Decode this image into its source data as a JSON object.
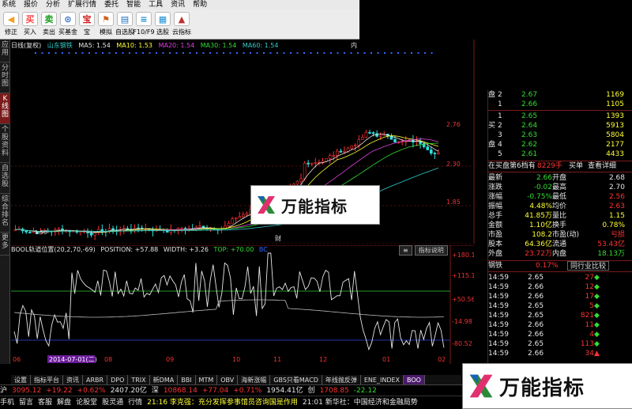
{
  "menu": [
    "系统",
    "报价",
    "分析",
    "扩展行情",
    "委托",
    "智能",
    "工具",
    "资讯",
    "帮助"
  ],
  "toolbar": [
    {
      "label": "修正",
      "icon": "back-arrow",
      "color": "#f0a020",
      "glyph": "◀"
    },
    {
      "label": "买入",
      "icon": "buy",
      "color": "#ff4040",
      "glyph": "买"
    },
    {
      "label": "卖出",
      "icon": "sell",
      "color": "#20a020",
      "glyph": "卖"
    },
    {
      "label": "买基金",
      "icon": "fund",
      "color": "#2060c0",
      "glyph": "⊙"
    },
    {
      "label": "宝",
      "icon": "treasure",
      "color": "#d02020",
      "glyph": "宝"
    },
    {
      "label": "模拟",
      "icon": "simulate",
      "color": "#d06020",
      "glyph": "⚑"
    },
    {
      "label": "自选股",
      "icon": "watchlist",
      "color": "#2070c0",
      "glyph": "▤"
    },
    {
      "label": "F10/F9",
      "icon": "f10",
      "color": "#2090d0",
      "glyph": "≡"
    },
    {
      "label": "选股",
      "icon": "screener",
      "color": "#2090d0",
      "glyph": "▦"
    },
    {
      "label": "云指标",
      "icon": "cloud-indicator",
      "color": "#c03030",
      "glyph": "▲"
    }
  ],
  "lefttabs": [
    {
      "label": "应用",
      "active": false
    },
    {
      "label": "分时图",
      "active": false
    },
    {
      "label": "K线图",
      "active": true
    },
    {
      "label": "个股资料",
      "active": false
    },
    {
      "label": "自选股",
      "active": false
    },
    {
      "label": "综合排名",
      "active": false
    },
    {
      "label": "更多",
      "active": false
    }
  ],
  "chart_header": {
    "period": "日线(复权)",
    "stock": "山东钢铁",
    "ma5": "MA5: 1.54",
    "ma10": "MA10: 1.53",
    "ma20": "MA20: 1.54",
    "ma30": "MA30: 1.54",
    "ma60": "MA60: 1.54"
  },
  "kline_axis": [
    "2.76",
    "2.30",
    "1.85"
  ],
  "kline_low_label": "1.50",
  "kline_high_label": "内",
  "kline_marker": "财",
  "osc_header": {
    "name": "BOOL轨道位置(20,2,70,-69)",
    "position": "POSITION: +57.88",
    "width": "WIDTH: +3.26",
    "top": "TOP: +70.00",
    "bc": "BC"
  },
  "osc_buttons": [
    "≡",
    "指标说明"
  ],
  "osc_axis": [
    "+180.1",
    "+115.1",
    "+50.56",
    "-14.98",
    "-80.52"
  ],
  "date_labels": [
    "06",
    "08",
    "09",
    "10",
    "11",
    "12",
    "01",
    "02"
  ],
  "date_selected": "2014-07-01(二)",
  "bottom_tabs": [
    {
      "label": "设置",
      "active": false
    },
    {
      "label": "指标平台",
      "active": false
    },
    {
      "label": "资讯",
      "active": false
    },
    {
      "label": "ARBR",
      "active": false
    },
    {
      "label": "DPO",
      "active": false
    },
    {
      "label": "TRIX",
      "active": false
    },
    {
      "label": "新DMA",
      "active": false
    },
    {
      "label": "BBI",
      "active": false
    },
    {
      "label": "MTM",
      "active": false
    },
    {
      "label": "OBV",
      "active": false
    },
    {
      "label": "海新涨幅",
      "active": false
    },
    {
      "label": "GBS只看MACD",
      "active": false
    },
    {
      "label": "年线抛反弹",
      "active": false
    },
    {
      "label": "ENE_INDEX",
      "active": false
    },
    {
      "label": "BOO",
      "active": true
    }
  ],
  "orderbook": {
    "sell": [
      {
        "level": "2",
        "price": "2.67",
        "vol": "1169"
      },
      {
        "level": "1",
        "price": "2.66",
        "vol": "1105"
      }
    ],
    "buy_label": "买",
    "buy": [
      {
        "level": "1",
        "price": "2.65",
        "vol": "1393"
      },
      {
        "level": "2",
        "price": "2.64",
        "vol": "5913"
      },
      {
        "level": "3",
        "price": "2.63",
        "vol": "5804"
      },
      {
        "level": "4",
        "price": "2.62",
        "vol": "2177"
      },
      {
        "level": "5",
        "price": "2.61",
        "vol": "4433"
      }
    ],
    "sell_label": "盘",
    "side_label1": "买",
    "side_label2": "盘",
    "queue_label": "在买盘第6档有",
    "queue_vol": "8229手",
    "queue_btn1": "买单",
    "queue_btn2": "查看详细"
  },
  "quote": [
    {
      "k1": "最新",
      "v1": "2.66",
      "k2": "开盘",
      "v2": "2.68"
    },
    {
      "k1": "涨跌",
      "v1": "-0.02",
      "k2": "最高",
      "v2": "2.70"
    },
    {
      "k1": "涨幅",
      "v1": "-0.75%",
      "k2": "最低",
      "v2": "2.56"
    },
    {
      "k1": "振幅",
      "v1": "4.48%",
      "k2": "均价",
      "v2": "2.63"
    },
    {
      "k1": "总手",
      "v1": "41.85万",
      "k2": "量比",
      "v2": "1.15"
    },
    {
      "k1": "金额",
      "v1": "1.10亿",
      "k2": "换手",
      "v2": "0.78%"
    },
    {
      "k1": "市盈",
      "v1": "108.2",
      "k2": "市盈(动)",
      "v2": "亏损"
    },
    {
      "k1": "股本",
      "v1": "64.36亿",
      "k2": "流通",
      "v2": "53.43亿"
    },
    {
      "k1": "外盘",
      "v1": "23.72万",
      "k2": "内盘",
      "v2": "18.13万"
    }
  ],
  "sector": {
    "name": "钢铁",
    "change": "0.17%",
    "btn": "同行业比较"
  },
  "ticks": [
    {
      "time": "14:59",
      "price": "2.65",
      "vol": "27",
      "dir": "down"
    },
    {
      "time": "14:59",
      "price": "2.66",
      "vol": "12",
      "dir": "down"
    },
    {
      "time": "14:59",
      "price": "2.66",
      "vol": "17",
      "dir": "down"
    },
    {
      "time": "14:59",
      "price": "2.65",
      "vol": "5",
      "dir": "down"
    },
    {
      "time": "14:59",
      "price": "2.65",
      "vol": "821",
      "dir": "down"
    },
    {
      "time": "14:59",
      "price": "2.66",
      "vol": "11",
      "dir": "down"
    },
    {
      "time": "14:59",
      "price": "2.66",
      "vol": "4",
      "dir": "down"
    },
    {
      "time": "14:59",
      "price": "2.65",
      "vol": "113",
      "dir": "down"
    },
    {
      "time": "14:59",
      "price": "2.66",
      "vol": "34",
      "dir": "up"
    }
  ],
  "indexbar": [
    {
      "text": "沪",
      "cls": "wht"
    },
    {
      "text": "3095.12",
      "cls": "red"
    },
    {
      "text": "+19.22",
      "cls": "red"
    },
    {
      "text": "+0.62%",
      "cls": "red"
    },
    {
      "text": "2407.20亿",
      "cls": "wht"
    },
    {
      "text": "深",
      "cls": "wht"
    },
    {
      "text": "10868.14",
      "cls": "red"
    },
    {
      "text": "+77.04",
      "cls": "red"
    },
    {
      "text": "+0.71%",
      "cls": "red"
    },
    {
      "text": "1954.41亿",
      "cls": "wht"
    },
    {
      "text": "创",
      "cls": "wht"
    },
    {
      "text": "1708.85",
      "cls": "red"
    },
    {
      "text": "-22.12",
      "cls": "grn"
    }
  ],
  "tickerbar": [
    {
      "text": "手机",
      "cls": "wht"
    },
    {
      "text": "留言",
      "cls": "wht"
    },
    {
      "text": "客服",
      "cls": "wht"
    },
    {
      "text": "解盘",
      "cls": "wht"
    },
    {
      "text": "论股堂",
      "cls": "wht"
    },
    {
      "text": "股灵通",
      "cls": "wht"
    },
    {
      "text": "行情",
      "cls": "wht"
    },
    {
      "text": "21:16 李克强：充分发挥参事馆员咨询国是作用",
      "cls": "yel"
    },
    {
      "text": "21:01 新华社：中国经济和金融局势",
      "cls": "wht"
    }
  ],
  "watermark_text": "万能指标"
}
